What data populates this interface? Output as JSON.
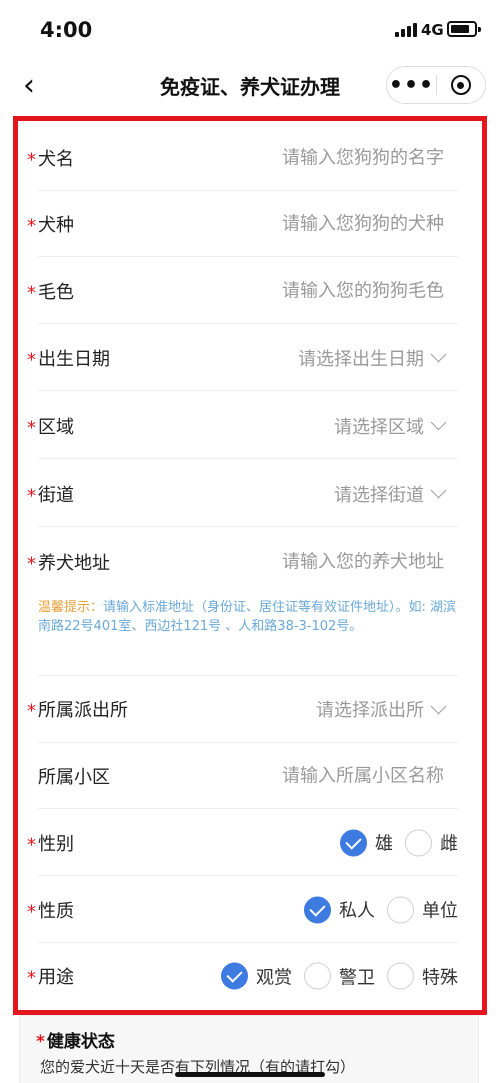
{
  "status_bar": {
    "time": "4:00",
    "network": "4G"
  },
  "nav": {
    "title": "免疫证、养犬证办理",
    "more": "•••"
  },
  "form": {
    "dog_name": {
      "label": "犬名",
      "placeholder": "请输入您狗狗的名字"
    },
    "breed": {
      "label": "犬种",
      "placeholder": "请输入您狗狗的犬种"
    },
    "coat_color": {
      "label": "毛色",
      "placeholder": "请输入您的狗狗毛色"
    },
    "birth_date": {
      "label": "出生日期",
      "value": "请选择出生日期"
    },
    "district": {
      "label": "区域",
      "value": "请选择区域"
    },
    "street": {
      "label": "街道",
      "value": "请选择街道"
    },
    "address": {
      "label": "养犬地址",
      "placeholder": "请输入您的养犬地址"
    },
    "tip": {
      "head": "温馨提示：",
      "body": "请输入标准地址（身份证、居住证等有效证件地址）。如: 湖滨南路22号401室、西边社121号 、人和路38-3-102号。"
    },
    "police_station": {
      "label": "所属派出所",
      "value": "请选择派出所"
    },
    "community": {
      "label": "所属小区",
      "placeholder": "请输入所属小区名称"
    },
    "gender": {
      "label": "性别",
      "options": [
        "雄",
        "雌"
      ],
      "selected": "雄"
    },
    "nature": {
      "label": "性质",
      "options": [
        "私人",
        "单位"
      ],
      "selected": "私人"
    },
    "usage": {
      "label": "用途",
      "options": [
        "观赏",
        "警卫",
        "特殊"
      ],
      "selected": "观赏"
    }
  },
  "health": {
    "title": "健康状态",
    "desc": "您的爱犬近十天是否有下列情况（有的请打勾）"
  },
  "colors": {
    "accent": "#3d7be0",
    "required": "#e3151d",
    "frame": "#e3151d",
    "tip": "#6aa9d6",
    "tip_head": "#e9a13a"
  }
}
